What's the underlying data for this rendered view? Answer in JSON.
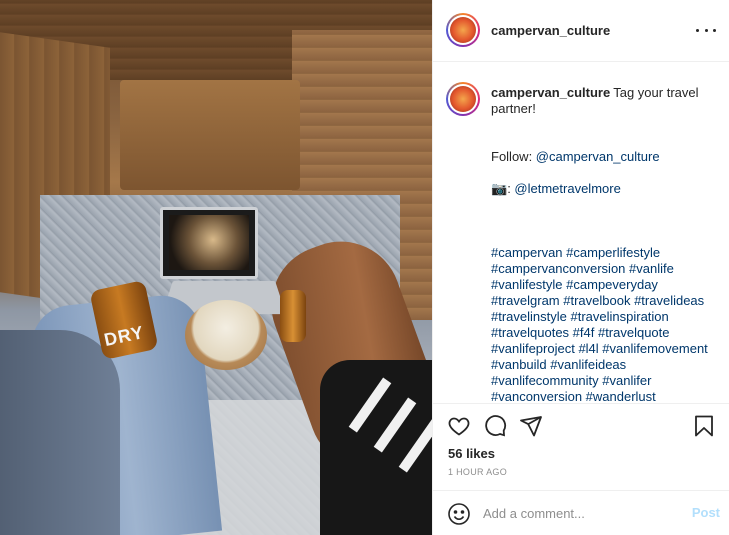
{
  "post": {
    "image_icon": "campervan-photo",
    "username": "campervan_culture",
    "header_more_icon": "more-horizontal-icon"
  },
  "caption": {
    "username": "campervan_culture",
    "text": "Tag your travel partner!",
    "follow_prefix": "Follow: ",
    "follow_handle": "@campervan_culture",
    "camera_emoji": "📷",
    "photo_credit": "@letmetravelmore",
    "hashtag_lines": [
      "#campervan #camperlifestyle",
      "#campervanconversion #vanlife",
      "#vanlifestyle #campeveryday",
      "#travelgram #travelbook #travelideas",
      "#travelinstyle #travelinspiration",
      "#travelquotes #f4f #travelquote",
      "#vanlifeproject #l4l #vanlifemovement",
      "#vanbuild #vanlifeideas",
      "#vanlifecommunity #vanlifer",
      "#vanconversion #wanderlust"
    ]
  },
  "photo": {
    "bottle_text": "DRY"
  },
  "actions": {
    "like_icon": "heart-icon",
    "comment_icon": "comment-bubble-icon",
    "share_icon": "paper-plane-icon",
    "save_icon": "bookmark-icon"
  },
  "likes": "56 likes",
  "time": "1 HOUR AGO",
  "add_comment": {
    "emoji_icon": "smiley-icon",
    "placeholder": "Add a comment...",
    "post_label": "Post"
  },
  "colors": {
    "link": "#00376b",
    "post_disabled": "#b2dffc",
    "muted": "#8e8e8e",
    "border": "#efefef"
  }
}
